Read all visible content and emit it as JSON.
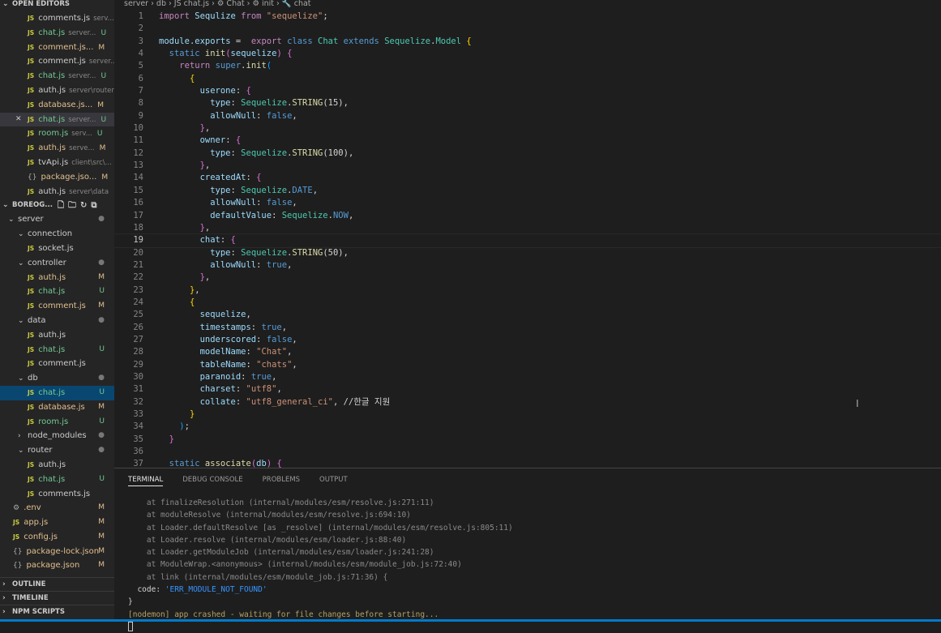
{
  "sidebar": {
    "open_editors_title": "OPEN EDITORS",
    "open_editors": [
      {
        "name": "comments.js",
        "desc": "serv...",
        "badge": "",
        "cls": ""
      },
      {
        "name": "chat.js",
        "desc": "server...",
        "badge": "U",
        "cls": "U"
      },
      {
        "name": "comment.js...",
        "desc": "",
        "badge": "M",
        "cls": "M"
      },
      {
        "name": "comment.js",
        "desc": "server...",
        "badge": "",
        "cls": ""
      },
      {
        "name": "chat.js",
        "desc": "server...",
        "badge": "U",
        "cls": "U"
      },
      {
        "name": "auth.js",
        "desc": "server\\router",
        "badge": "",
        "cls": ""
      },
      {
        "name": "database.js...",
        "desc": "",
        "badge": "M",
        "cls": "M"
      },
      {
        "name": "chat.js",
        "desc": "server...",
        "badge": "U",
        "cls": "U",
        "active": true
      },
      {
        "name": "room.js",
        "desc": "serv...",
        "badge": "U",
        "cls": "U"
      },
      {
        "name": "auth.js",
        "desc": "serve...",
        "badge": "M",
        "cls": "M"
      },
      {
        "name": "tvApi.js",
        "desc": "client\\src\\...",
        "badge": "",
        "cls": ""
      },
      {
        "name": "package.jso...",
        "desc": "",
        "badge": "M",
        "cls": "M",
        "icon": "{}"
      },
      {
        "name": "auth.js",
        "desc": "server\\data",
        "badge": "",
        "cls": ""
      }
    ],
    "project_title": "BOREOG...",
    "tree": [
      {
        "name": "server",
        "depth": 0,
        "folder": true,
        "badge": "●",
        "cls": "D"
      },
      {
        "name": "connection",
        "depth": 1,
        "folder": true,
        "badge": "",
        "cls": ""
      },
      {
        "name": "socket.js",
        "depth": 2,
        "badge": "",
        "cls": ""
      },
      {
        "name": "controller",
        "depth": 1,
        "folder": true,
        "badge": "●",
        "cls": "D"
      },
      {
        "name": "auth.js",
        "depth": 2,
        "badge": "M",
        "cls": "M"
      },
      {
        "name": "chat.js",
        "depth": 2,
        "badge": "U",
        "cls": "U"
      },
      {
        "name": "comment.js",
        "depth": 2,
        "badge": "M",
        "cls": "M"
      },
      {
        "name": "data",
        "depth": 1,
        "folder": true,
        "badge": "●",
        "cls": "D"
      },
      {
        "name": "auth.js",
        "depth": 2,
        "badge": "",
        "cls": ""
      },
      {
        "name": "chat.js",
        "depth": 2,
        "badge": "U",
        "cls": "U"
      },
      {
        "name": "comment.js",
        "depth": 2,
        "badge": "",
        "cls": ""
      },
      {
        "name": "db",
        "depth": 1,
        "folder": true,
        "badge": "●",
        "cls": "D"
      },
      {
        "name": "chat.js",
        "depth": 2,
        "badge": "U",
        "cls": "U",
        "selected": true
      },
      {
        "name": "database.js",
        "depth": 2,
        "badge": "M",
        "cls": "M"
      },
      {
        "name": "room.js",
        "depth": 2,
        "badge": "U",
        "cls": "U"
      },
      {
        "name": "node_modules",
        "depth": 1,
        "folder": true,
        "collapsed": true,
        "badge": "●",
        "cls": "D"
      },
      {
        "name": "router",
        "depth": 1,
        "folder": true,
        "badge": "●",
        "cls": "D"
      },
      {
        "name": "auth.js",
        "depth": 2,
        "badge": "",
        "cls": ""
      },
      {
        "name": "chat.js",
        "depth": 2,
        "badge": "U",
        "cls": "U"
      },
      {
        "name": "comments.js",
        "depth": 2,
        "badge": "",
        "cls": ""
      },
      {
        "name": ".env",
        "depth": 0.5,
        "badge": "M",
        "cls": "M",
        "icon": "⚙"
      },
      {
        "name": "app.js",
        "depth": 0.5,
        "badge": "M",
        "cls": "M"
      },
      {
        "name": "config.js",
        "depth": 0.5,
        "badge": "M",
        "cls": "M"
      },
      {
        "name": "package-lock.json",
        "depth": 0.5,
        "badge": "M",
        "cls": "M",
        "icon": "{}"
      },
      {
        "name": "package.json",
        "depth": 0.5,
        "badge": "M",
        "cls": "M",
        "icon": "{}"
      }
    ],
    "outline": "OUTLINE",
    "timeline": "TIMELINE",
    "npm": "NPM SCRIPTS"
  },
  "breadcrumb": "server › db › JS chat.js › ⚙ Chat › ⚙ init › 🔧 chat",
  "editor": {
    "current_line": 19,
    "lines": [
      [
        [
          "ct",
          "import "
        ],
        [
          "id",
          "Sequlize "
        ],
        [
          "ct",
          "from "
        ],
        [
          "str",
          "\"sequelize\""
        ],
        [
          "pl",
          ";"
        ]
      ],
      [],
      [
        [
          "id",
          "module"
        ],
        [
          "pl",
          "."
        ],
        [
          "id",
          "exports "
        ],
        [
          "pl",
          "=  "
        ],
        [
          "ct",
          "export "
        ],
        [
          "kw",
          "class "
        ],
        [
          "cls",
          "Chat "
        ],
        [
          "kw",
          "extends "
        ],
        [
          "cls",
          "Sequelize"
        ],
        [
          "pl",
          "."
        ],
        [
          "cls",
          "Model "
        ],
        [
          "br1",
          "{"
        ]
      ],
      [
        [
          "pl",
          "  "
        ],
        [
          "kw",
          "static "
        ],
        [
          "fn",
          "init"
        ],
        [
          "br2",
          "("
        ],
        [
          "id",
          "sequelize"
        ],
        [
          "br2",
          ")"
        ],
        [
          "pl",
          " "
        ],
        [
          "br2",
          "{"
        ]
      ],
      [
        [
          "pl",
          "    "
        ],
        [
          "ct",
          "return "
        ],
        [
          "kw",
          "super"
        ],
        [
          "pl",
          "."
        ],
        [
          "fn",
          "init"
        ],
        [
          "br3",
          "("
        ]
      ],
      [
        [
          "pl",
          "      "
        ],
        [
          "br1",
          "{"
        ]
      ],
      [
        [
          "pl",
          "        "
        ],
        [
          "id",
          "userone"
        ],
        [
          "pl",
          ": "
        ],
        [
          "br2",
          "{"
        ]
      ],
      [
        [
          "pl",
          "          "
        ],
        [
          "id",
          "type"
        ],
        [
          "pl",
          ": "
        ],
        [
          "cls",
          "Sequelize"
        ],
        [
          "pl",
          "."
        ],
        [
          "fn",
          "STRING"
        ],
        [
          "pl",
          "(15),"
        ]
      ],
      [
        [
          "pl",
          "          "
        ],
        [
          "id",
          "allowNull"
        ],
        [
          "pl",
          ": "
        ],
        [
          "kw",
          "false"
        ],
        [
          "pl",
          ","
        ]
      ],
      [
        [
          "pl",
          "        "
        ],
        [
          "br2",
          "}"
        ],
        [
          "pl",
          ","
        ]
      ],
      [
        [
          "pl",
          "        "
        ],
        [
          "id",
          "owner"
        ],
        [
          "pl",
          ": "
        ],
        [
          "br2",
          "{"
        ]
      ],
      [
        [
          "pl",
          "          "
        ],
        [
          "id",
          "type"
        ],
        [
          "pl",
          ": "
        ],
        [
          "cls",
          "Sequelize"
        ],
        [
          "pl",
          "."
        ],
        [
          "fn",
          "STRING"
        ],
        [
          "pl",
          "(100),"
        ]
      ],
      [
        [
          "pl",
          "        "
        ],
        [
          "br2",
          "}"
        ],
        [
          "pl",
          ","
        ]
      ],
      [
        [
          "pl",
          "        "
        ],
        [
          "id",
          "createdAt"
        ],
        [
          "pl",
          ": "
        ],
        [
          "br2",
          "{"
        ]
      ],
      [
        [
          "pl",
          "          "
        ],
        [
          "id",
          "type"
        ],
        [
          "pl",
          ": "
        ],
        [
          "cls",
          "Sequelize"
        ],
        [
          "pl",
          "."
        ],
        [
          "kw",
          "DATE"
        ],
        [
          "pl",
          ","
        ]
      ],
      [
        [
          "pl",
          "          "
        ],
        [
          "id",
          "allowNull"
        ],
        [
          "pl",
          ": "
        ],
        [
          "kw",
          "false"
        ],
        [
          "pl",
          ","
        ]
      ],
      [
        [
          "pl",
          "          "
        ],
        [
          "id",
          "defaultValue"
        ],
        [
          "pl",
          ": "
        ],
        [
          "cls",
          "Sequelize"
        ],
        [
          "pl",
          "."
        ],
        [
          "kw",
          "NOW"
        ],
        [
          "pl",
          ","
        ]
      ],
      [
        [
          "pl",
          "        "
        ],
        [
          "br2",
          "}"
        ],
        [
          "pl",
          ","
        ]
      ],
      [
        [
          "pl",
          "        "
        ],
        [
          "id",
          "chat"
        ],
        [
          "pl",
          ": "
        ],
        [
          "br2",
          "{"
        ]
      ],
      [
        [
          "pl",
          "          "
        ],
        [
          "id",
          "type"
        ],
        [
          "pl",
          ": "
        ],
        [
          "cls",
          "Sequelize"
        ],
        [
          "pl",
          "."
        ],
        [
          "fn",
          "STRING"
        ],
        [
          "pl",
          "(50),"
        ]
      ],
      [
        [
          "pl",
          "          "
        ],
        [
          "id",
          "allowNull"
        ],
        [
          "pl",
          ": "
        ],
        [
          "kw",
          "true"
        ],
        [
          "pl",
          ","
        ]
      ],
      [
        [
          "pl",
          "        "
        ],
        [
          "br2",
          "}"
        ],
        [
          "pl",
          ","
        ]
      ],
      [
        [
          "pl",
          "      "
        ],
        [
          "br1",
          "}"
        ],
        [
          "pl",
          ","
        ]
      ],
      [
        [
          "pl",
          "      "
        ],
        [
          "br1",
          "{"
        ]
      ],
      [
        [
          "pl",
          "        "
        ],
        [
          "id",
          "sequelize"
        ],
        [
          "pl",
          ","
        ]
      ],
      [
        [
          "pl",
          "        "
        ],
        [
          "id",
          "timestamps"
        ],
        [
          "pl",
          ": "
        ],
        [
          "kw",
          "true"
        ],
        [
          "pl",
          ","
        ]
      ],
      [
        [
          "pl",
          "        "
        ],
        [
          "id",
          "underscored"
        ],
        [
          "pl",
          ": "
        ],
        [
          "kw",
          "false"
        ],
        [
          "pl",
          ","
        ]
      ],
      [
        [
          "pl",
          "        "
        ],
        [
          "id",
          "modelName"
        ],
        [
          "pl",
          ": "
        ],
        [
          "str",
          "\"Chat\""
        ],
        [
          "pl",
          ","
        ]
      ],
      [
        [
          "pl",
          "        "
        ],
        [
          "id",
          "tableName"
        ],
        [
          "pl",
          ": "
        ],
        [
          "str",
          "\"chats\""
        ],
        [
          "pl",
          ","
        ]
      ],
      [
        [
          "pl",
          "        "
        ],
        [
          "id",
          "paranoid"
        ],
        [
          "pl",
          ": "
        ],
        [
          "kw",
          "true"
        ],
        [
          "pl",
          ","
        ]
      ],
      [
        [
          "pl",
          "        "
        ],
        [
          "id",
          "charset"
        ],
        [
          "pl",
          ": "
        ],
        [
          "str",
          "\"utf8\""
        ],
        [
          "pl",
          ","
        ]
      ],
      [
        [
          "pl",
          "        "
        ],
        [
          "id",
          "collate"
        ],
        [
          "pl",
          ": "
        ],
        [
          "str",
          "\"utf8_general_ci\""
        ],
        [
          "pl",
          ", "
        ],
        [
          "pl",
          "//한글 지원"
        ]
      ],
      [
        [
          "pl",
          "      "
        ],
        [
          "br1",
          "}"
        ]
      ],
      [
        [
          "pl",
          "    "
        ],
        [
          "br3",
          ")"
        ],
        [
          "pl",
          ";"
        ]
      ],
      [
        [
          "pl",
          "  "
        ],
        [
          "br2",
          "}"
        ]
      ],
      [],
      [
        [
          "pl",
          "  "
        ],
        [
          "kw",
          "static "
        ],
        [
          "fn",
          "associate"
        ],
        [
          "br2",
          "("
        ],
        [
          "id",
          "db"
        ],
        [
          "br2",
          ")"
        ],
        [
          "pl",
          " "
        ],
        [
          "br2",
          "{"
        ]
      ]
    ]
  },
  "panel": {
    "tabs": [
      "TERMINAL",
      "DEBUG CONSOLE",
      "PROBLEMS",
      "OUTPUT"
    ],
    "terminal": [
      {
        "t": "    at finalizeResolution (internal/modules/esm/resolve.js:271:11)",
        "c": ""
      },
      {
        "t": "    at moduleResolve (internal/modules/esm/resolve.js:694:10)",
        "c": ""
      },
      {
        "t": "    at Loader.defaultResolve [as _resolve] (internal/modules/esm/resolve.js:805:11)",
        "c": ""
      },
      {
        "t": "    at Loader.resolve (internal/modules/esm/loader.js:88:40)",
        "c": ""
      },
      {
        "t": "    at Loader.getModuleJob (internal/modules/esm/loader.js:241:28)",
        "c": ""
      },
      {
        "t": "    at ModuleWrap.<anonymous> (internal/modules/esm/module_job.js:72:40)",
        "c": ""
      },
      {
        "t": "    at link (internal/modules/esm/module_job.js:71:36) {",
        "c": ""
      },
      {
        "t": "  code: ",
        "c": "w",
        "extra": "'ERR_MODULE_NOT_FOUND'"
      },
      {
        "t": "}",
        "c": "w"
      },
      {
        "t": "[nodemon] app crashed - waiting for file changes before starting...",
        "c": "y"
      }
    ]
  }
}
